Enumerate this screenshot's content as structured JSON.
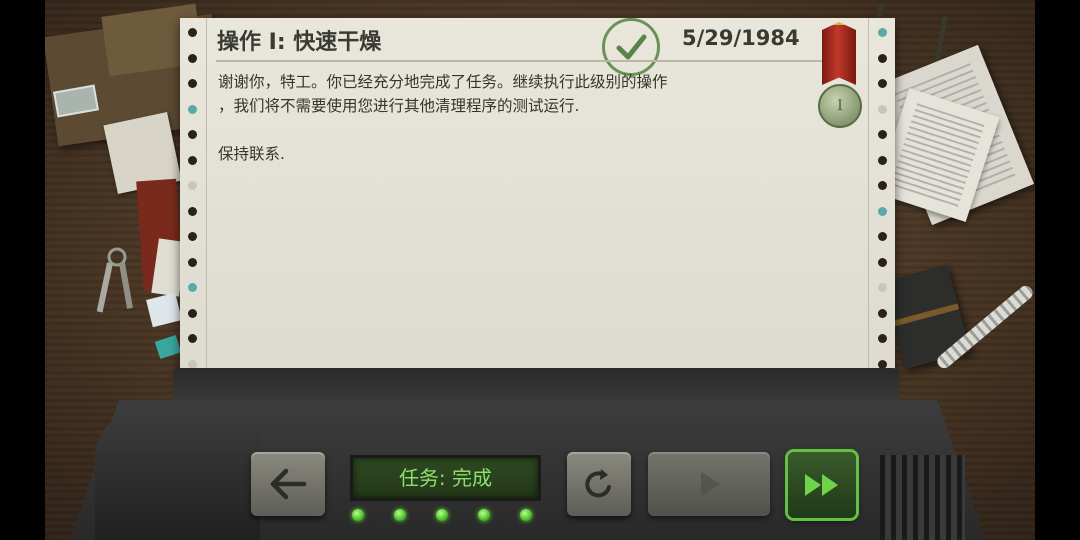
{
  "report": {
    "title": "操作 I: 快速干燥",
    "date": "5/29/1984",
    "message_line1": "谢谢你，特工。你已经充分地完成了任务。继续执行此级别的操作",
    "message_line2": "，我们将不需要使用您进行其他清理程序的测试运行.",
    "signoff": "保持联系."
  },
  "medal": {
    "label": "I"
  },
  "controls": {
    "status_text": "任务: 完成",
    "status_color": "#8de06a",
    "led_count": 5,
    "back_icon": "arrow-left-icon",
    "reset_icon": "refresh-icon",
    "play_icon": "play-icon",
    "fast_forward_icon": "fast-forward-icon",
    "accent": "#63c241"
  }
}
